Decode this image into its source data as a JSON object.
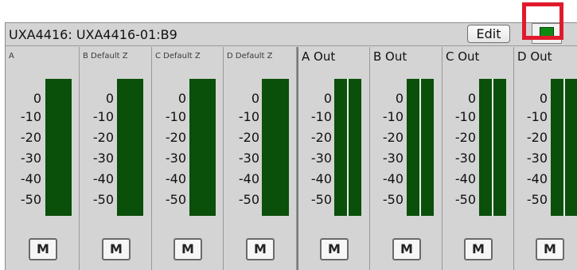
{
  "device": {
    "title": "UXA4416: UXA4416-01:B9"
  },
  "toolbar": {
    "edit_label": "Edit"
  },
  "status": {
    "led_color": "#0e8a12",
    "highlight_color": "#e01a2c"
  },
  "scale_ticks": [
    "0",
    "-10",
    "-20",
    "-30",
    "-40",
    "-50"
  ],
  "channels": [
    {
      "label": "A",
      "mute_label": "M"
    },
    {
      "label": "B Default Z",
      "mute_label": "M"
    },
    {
      "label": "C Default Z",
      "mute_label": "M"
    },
    {
      "label": "D Default Z",
      "mute_label": "M"
    },
    {
      "label": "A Out",
      "mute_label": "M"
    },
    {
      "label": "B Out",
      "mute_label": "M"
    },
    {
      "label": "C Out",
      "mute_label": "M"
    },
    {
      "label": "D Out",
      "mute_label": "M"
    }
  ]
}
